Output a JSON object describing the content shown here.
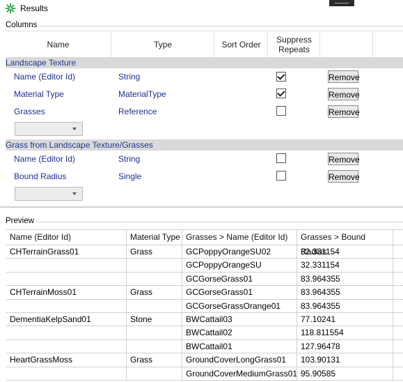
{
  "window": {
    "title": "Results"
  },
  "columns_group": {
    "label": "Columns",
    "headers": [
      "Name",
      "Type",
      "Sort Order",
      "Suppress\nRepeats"
    ],
    "sections": [
      {
        "title": "Landscape Texture",
        "rows": [
          {
            "name": "Name (Editor Id)",
            "type": "String",
            "suppress": true,
            "button": "Remove"
          },
          {
            "name": "Material Type",
            "type": "MaterialType",
            "suppress": true,
            "button": "Remove"
          },
          {
            "name": "Grasses",
            "type": "Reference",
            "suppress": false,
            "button": "Remove"
          }
        ],
        "combo_value": ""
      },
      {
        "title": "Grass from Landscape Texture/Grasses",
        "rows": [
          {
            "name": "Name (Editor Id)",
            "type": "String",
            "suppress": false,
            "button": "Remove"
          },
          {
            "name": "Bound Radius",
            "type": "Single",
            "suppress": false,
            "button": "Remove"
          }
        ],
        "combo_value": ""
      }
    ]
  },
  "preview": {
    "label": "Preview",
    "headers": [
      "Name (Editor Id)",
      "Material Type",
      "Grasses > Name (Editor Id)",
      "Grasses > Bound Radius"
    ],
    "rows": [
      [
        "CHTerrainGrass01",
        "Grass",
        "GCPoppyOrangeSU02",
        "32.331154"
      ],
      [
        "",
        "",
        "GCPoppyOrangeSU",
        "32.331154"
      ],
      [
        "",
        "",
        "GCGorseGrass01",
        "83.964355"
      ],
      [
        "CHTerrainMoss01",
        "Grass",
        "GCGorseGrass01",
        "83.964355"
      ],
      [
        "",
        "",
        "GCGorseGrassOrange01",
        "83.964355"
      ],
      [
        "DementiaKelpSand01",
        "Stone",
        "BWCattail03",
        "77.10241"
      ],
      [
        "",
        "",
        "BWCattail02",
        "118.811554"
      ],
      [
        "",
        "",
        "BWCattail01",
        "127.96478"
      ],
      [
        "HeartGrassMoss",
        "Grass",
        "GroundCoverLongGrass01",
        "103.90131"
      ],
      [
        "",
        "",
        "GroundCoverMediumGrass01",
        "95.90585"
      ]
    ]
  }
}
